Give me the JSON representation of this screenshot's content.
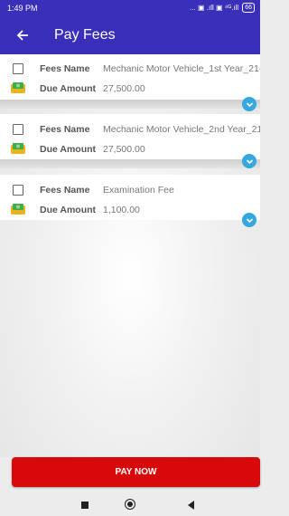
{
  "status_bar": {
    "time": "1:49 PM",
    "icons_text": "... ▣ .ıll ▣ ⁴ᴳ.ıll",
    "battery": "66"
  },
  "app_bar": {
    "title": "Pay Fees",
    "back_icon": "arrow-left-icon"
  },
  "fees": [
    {
      "name_label": "Fees Name",
      "name": "Mechanic Motor Vehicle_1st Year_21-",
      "due_label": "Due Amount",
      "due_amount": "27,500.00",
      "checked": false
    },
    {
      "name_label": "Fees Name",
      "name": "Mechanic Motor Vehicle_2nd Year_21",
      "due_label": "Due Amount",
      "due_amount": "27,500.00",
      "checked": false
    },
    {
      "name_label": "Fees Name",
      "name": "Examination Fee",
      "due_label": "Due Amount",
      "due_amount": "1,100.00",
      "checked": false
    }
  ],
  "pay_button": {
    "label": "PAY NOW"
  },
  "colors": {
    "app_bar": "#3a2fb8",
    "pay_button": "#d60a0a",
    "expand_icon": "#37a7e0"
  }
}
